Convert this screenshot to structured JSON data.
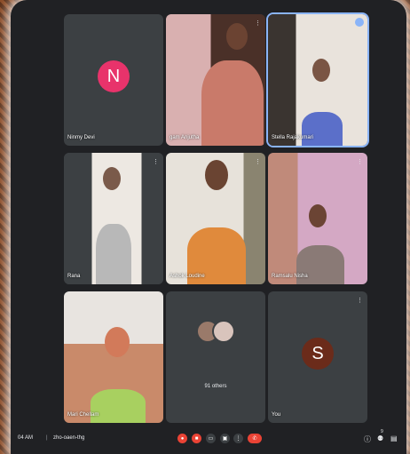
{
  "meeting": {
    "time": "04 AM",
    "separator": "|",
    "code": "zho-oaen-thg",
    "participant_count": "9"
  },
  "tiles": [
    {
      "name": "Ninmy Devi",
      "initial": "N",
      "avatar_color": "#e8336b"
    },
    {
      "name": "gam Anjutha"
    },
    {
      "name": "Stella Rajakumari"
    },
    {
      "name": "Rana"
    },
    {
      "name": "Ashok Loudine"
    },
    {
      "name": "Ramsalu Nisha"
    },
    {
      "name": "Mari Chellam"
    },
    {
      "name": "91 others"
    },
    {
      "name": "You",
      "initial": "S",
      "avatar_color": "#6b2b1a"
    }
  ],
  "icons": {
    "more": "⋮",
    "mic": "mic-off-icon",
    "cam": "camera-off-icon",
    "end": "hangup-icon"
  }
}
